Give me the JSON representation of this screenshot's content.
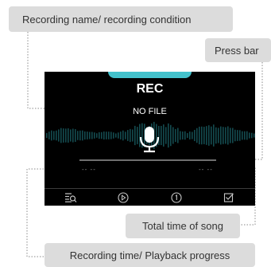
{
  "callouts": {
    "recording_name": "Recording name/ recording condition",
    "press_bar": "Press bar",
    "total_time": "Total time of song",
    "recording_time": "Recording time/ Playback progress"
  },
  "screen": {
    "title": "REC",
    "file_name": "NO FILE",
    "elapsed_time": "-- --",
    "total_time": "-- --",
    "progress": 0,
    "accent_color": "#44c2cc",
    "buttons": [
      {
        "icon": "list-search-icon"
      },
      {
        "icon": "play-icon"
      },
      {
        "icon": "one-icon"
      },
      {
        "icon": "checkbox-icon"
      }
    ]
  }
}
